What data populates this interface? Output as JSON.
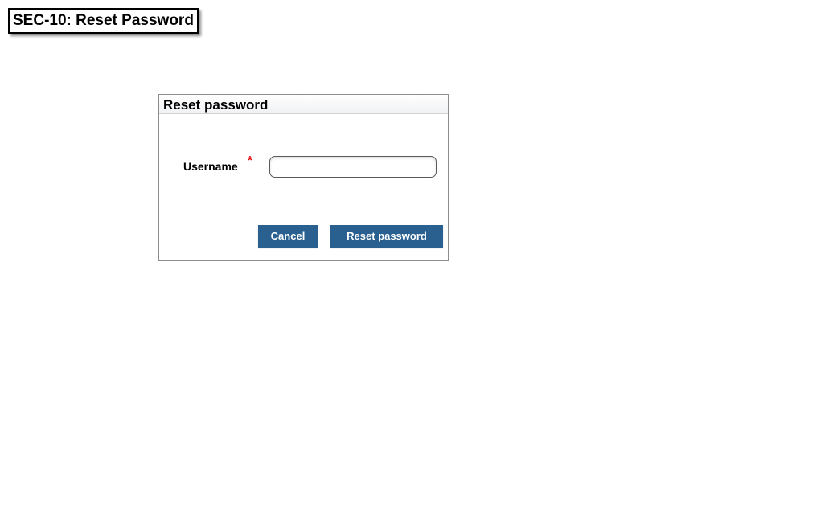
{
  "screen": {
    "tag": "SEC-10: Reset Password"
  },
  "dialog": {
    "title": "Reset password",
    "username": {
      "label": "Username",
      "required_mark": "*",
      "value": "",
      "placeholder": ""
    },
    "buttons": {
      "cancel": "Cancel",
      "reset": "Reset password"
    }
  },
  "colors": {
    "button_bg": "#29608f",
    "button_text": "#ffffff",
    "required": "#e00000"
  }
}
